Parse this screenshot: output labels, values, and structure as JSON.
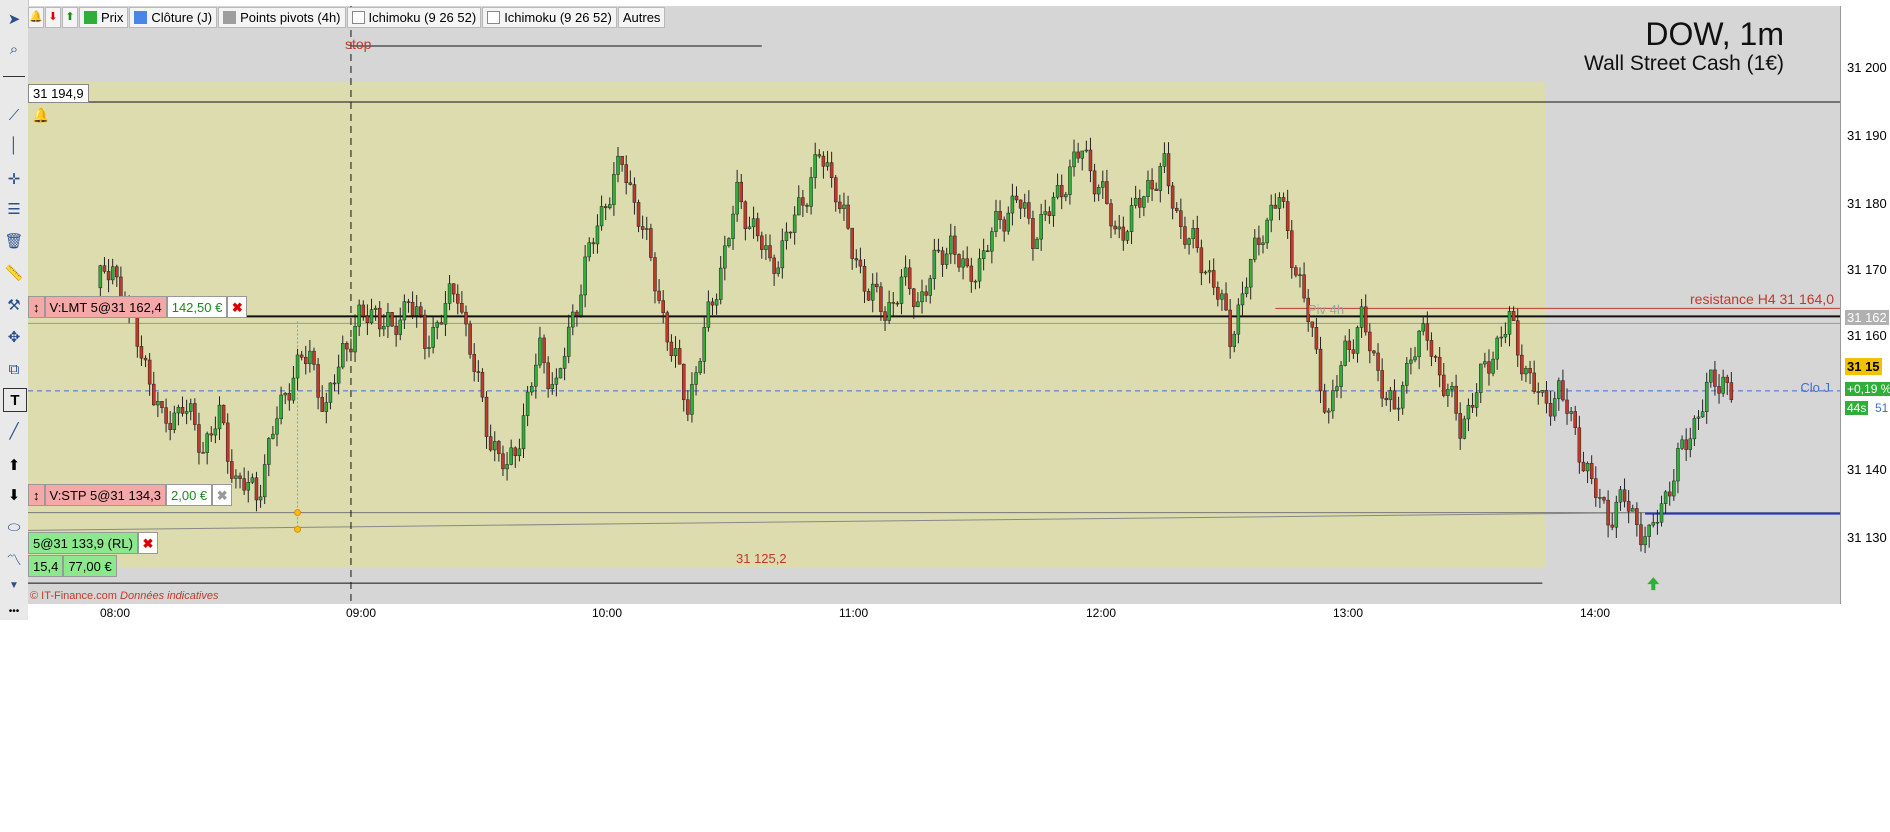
{
  "chart_data": {
    "type": "candlestick",
    "symbol": "DOW, 1m",
    "instrument": "Wall Street Cash (1€)",
    "x_ticks": [
      "08:00",
      "09:00",
      "10:00",
      "11:00",
      "12:00",
      "13:00",
      "14:00"
    ],
    "y_ticks": [
      "31 200",
      "31 190",
      "31 180",
      "31 170",
      "31 160",
      "31 140",
      "31 130"
    ],
    "ylim": [
      31121,
      31208
    ],
    "levels": {
      "resistance_h4": 31164.0,
      "piv_4h": 31162.0,
      "clo_j": 31152.0,
      "lmt_order": 31162.4,
      "stp_order": 31134.3,
      "position": 31133.9,
      "low_mark": 31125.2,
      "alert": 31194.9
    },
    "close_path": [
      {
        "t": "07:54",
        "v": 31167
      },
      {
        "t": "07:58",
        "v": 31170
      },
      {
        "t": "08:02",
        "v": 31163
      },
      {
        "t": "08:06",
        "v": 31156
      },
      {
        "t": "08:10",
        "v": 31147
      },
      {
        "t": "08:15",
        "v": 31150
      },
      {
        "t": "08:20",
        "v": 31144
      },
      {
        "t": "08:24",
        "v": 31148
      },
      {
        "t": "08:28",
        "v": 31139
      },
      {
        "t": "08:33",
        "v": 31137
      },
      {
        "t": "08:38",
        "v": 31148
      },
      {
        "t": "08:42",
        "v": 31155
      },
      {
        "t": "08:46",
        "v": 31157
      },
      {
        "t": "08:50",
        "v": 31149
      },
      {
        "t": "08:54",
        "v": 31158
      },
      {
        "t": "08:58",
        "v": 31162
      },
      {
        "t": "09:02",
        "v": 31164
      },
      {
        "t": "09:06",
        "v": 31160
      },
      {
        "t": "09:10",
        "v": 31166
      },
      {
        "t": "09:14",
        "v": 31159
      },
      {
        "t": "09:18",
        "v": 31163
      },
      {
        "t": "09:22",
        "v": 31167
      },
      {
        "t": "09:26",
        "v": 31155
      },
      {
        "t": "09:30",
        "v": 31145
      },
      {
        "t": "09:34",
        "v": 31140
      },
      {
        "t": "09:38",
        "v": 31148
      },
      {
        "t": "09:42",
        "v": 31158
      },
      {
        "t": "09:46",
        "v": 31152
      },
      {
        "t": "09:50",
        "v": 31163
      },
      {
        "t": "09:54",
        "v": 31172
      },
      {
        "t": "09:58",
        "v": 31180
      },
      {
        "t": "10:02",
        "v": 31185
      },
      {
        "t": "10:06",
        "v": 31178
      },
      {
        "t": "10:10",
        "v": 31168
      },
      {
        "t": "10:14",
        "v": 31158
      },
      {
        "t": "10:18",
        "v": 31150
      },
      {
        "t": "10:22",
        "v": 31160
      },
      {
        "t": "10:26",
        "v": 31170
      },
      {
        "t": "10:30",
        "v": 31180
      },
      {
        "t": "10:34",
        "v": 31176
      },
      {
        "t": "10:38",
        "v": 31170
      },
      {
        "t": "10:42",
        "v": 31174
      },
      {
        "t": "10:46",
        "v": 31180
      },
      {
        "t": "10:50",
        "v": 31186
      },
      {
        "t": "10:54",
        "v": 31182
      },
      {
        "t": "10:58",
        "v": 31172
      },
      {
        "t": "11:02",
        "v": 31167
      },
      {
        "t": "11:06",
        "v": 31163
      },
      {
        "t": "11:10",
        "v": 31168
      },
      {
        "t": "11:14",
        "v": 31165
      },
      {
        "t": "11:18",
        "v": 31170
      },
      {
        "t": "11:22",
        "v": 31174
      },
      {
        "t": "11:26",
        "v": 31168
      },
      {
        "t": "11:30",
        "v": 31172
      },
      {
        "t": "11:34",
        "v": 31177
      },
      {
        "t": "11:38",
        "v": 31180
      },
      {
        "t": "11:42",
        "v": 31175
      },
      {
        "t": "11:46",
        "v": 31178
      },
      {
        "t": "11:50",
        "v": 31183
      },
      {
        "t": "11:54",
        "v": 31187
      },
      {
        "t": "11:58",
        "v": 31182
      },
      {
        "t": "12:02",
        "v": 31175
      },
      {
        "t": "12:06",
        "v": 31177
      },
      {
        "t": "12:10",
        "v": 31182
      },
      {
        "t": "12:14",
        "v": 31184
      },
      {
        "t": "12:18",
        "v": 31176
      },
      {
        "t": "12:22",
        "v": 31172
      },
      {
        "t": "12:26",
        "v": 31168
      },
      {
        "t": "12:30",
        "v": 31160
      },
      {
        "t": "12:34",
        "v": 31168
      },
      {
        "t": "12:38",
        "v": 31176
      },
      {
        "t": "12:42",
        "v": 31180
      },
      {
        "t": "12:46",
        "v": 31170
      },
      {
        "t": "12:50",
        "v": 31160
      },
      {
        "t": "12:54",
        "v": 31148
      },
      {
        "t": "12:58",
        "v": 31158
      },
      {
        "t": "13:02",
        "v": 31162
      },
      {
        "t": "13:06",
        "v": 31155
      },
      {
        "t": "13:10",
        "v": 31148
      },
      {
        "t": "13:14",
        "v": 31158
      },
      {
        "t": "13:18",
        "v": 31160
      },
      {
        "t": "13:22",
        "v": 31153
      },
      {
        "t": "13:26",
        "v": 31147
      },
      {
        "t": "13:30",
        "v": 31152
      },
      {
        "t": "13:34",
        "v": 31158
      },
      {
        "t": "13:38",
        "v": 31162
      },
      {
        "t": "13:42",
        "v": 31155
      },
      {
        "t": "13:46",
        "v": 31150
      },
      {
        "t": "13:50",
        "v": 31152
      },
      {
        "t": "13:54",
        "v": 31146
      },
      {
        "t": "13:58",
        "v": 31138
      },
      {
        "t": "14:02",
        "v": 31134
      },
      {
        "t": "14:06",
        "v": 31136
      },
      {
        "t": "14:10",
        "v": 31132
      },
      {
        "t": "14:12",
        "v": 31130
      },
      {
        "t": "14:14",
        "v": 31134
      },
      {
        "t": "14:18",
        "v": 31140
      },
      {
        "t": "14:22",
        "v": 31146
      },
      {
        "t": "14:26",
        "v": 31152
      },
      {
        "t": "14:30",
        "v": 31154
      },
      {
        "t": "14:32",
        "v": 31152
      }
    ]
  },
  "toolbar": {
    "items": [
      "Prix",
      "Clôture (J)",
      "Points pivots (4h)",
      "Ichimoku (9 26 52)",
      "Ichimoku (9 26 52)",
      "Autres"
    ]
  },
  "labels": {
    "stop": "stop",
    "alert_price": "31 194,9",
    "resistance": "resistance H4 31 164,0",
    "piv": "Piv 4h",
    "clo": "Clo J",
    "low_mark": "31 125,2",
    "copyright": "© IT-Finance.com",
    "disclaimer": "Données indicatives",
    "axis_current_a": "31 162",
    "axis_current_b": "31 15",
    "axis_change": "+0,19 %",
    "axis_seconds": "44s",
    "axis_extra": "51"
  },
  "orders": {
    "lmt": {
      "label": "V:LMT 5@31 162,4",
      "value": "142,50 €"
    },
    "stp": {
      "label": "V:STP 5@31 134,3",
      "value": "2,00 €"
    },
    "position": {
      "label": "5@31 133,9 (RL)",
      "qty": "15,4",
      "value": "77,00 €"
    }
  },
  "colors": {
    "bull": "#2fae3a",
    "bear": "#c0392b",
    "zone": "#dcdcae",
    "resistance": "#c0392b",
    "clo_line": "#3b6fd8",
    "order_red": "#f4a8a8",
    "position_green": "#8de88d"
  }
}
